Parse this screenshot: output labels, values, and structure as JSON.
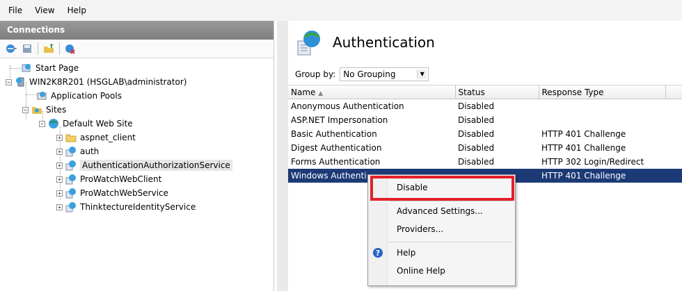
{
  "menubar": {
    "items": [
      "File",
      "View",
      "Help"
    ]
  },
  "connections": {
    "header": "Connections",
    "tree": {
      "start_page": "Start Page",
      "server": "WIN2K8R201 (HSGLAB\\administrator)",
      "app_pools": "Application Pools",
      "sites": "Sites",
      "default_site": "Default Web Site",
      "children": [
        "aspnet_client",
        "auth",
        "AuthenticationAuthorizationService",
        "ProWatchWebClient",
        "ProWatchWebService",
        "ThinktectureIdentityService"
      ],
      "selected": "AuthenticationAuthorizationService"
    }
  },
  "feature": {
    "title": "Authentication",
    "group_by_label": "Group by:",
    "group_by_value": "No Grouping",
    "columns": [
      "Name",
      "Status",
      "Response Type"
    ],
    "rows": [
      {
        "name": "Anonymous Authentication",
        "status": "Disabled",
        "response": ""
      },
      {
        "name": "ASP.NET Impersonation",
        "status": "Disabled",
        "response": ""
      },
      {
        "name": "Basic Authentication",
        "status": "Disabled",
        "response": "HTTP 401 Challenge"
      },
      {
        "name": "Digest Authentication",
        "status": "Disabled",
        "response": "HTTP 401 Challenge"
      },
      {
        "name": "Forms Authentication",
        "status": "Disabled",
        "response": "HTTP 302 Login/Redirect"
      },
      {
        "name": "Windows Authenti",
        "status": "",
        "response": "HTTP 401 Challenge"
      }
    ]
  },
  "context_menu": {
    "items": [
      "Disable",
      "Advanced Settings...",
      "Providers...",
      "Help",
      "Online Help"
    ],
    "highlighted": "Disable"
  },
  "colors": {
    "selection": "#1c3a76",
    "highlight_box": "#e3202a",
    "connections_header": "#8f8f8f"
  }
}
